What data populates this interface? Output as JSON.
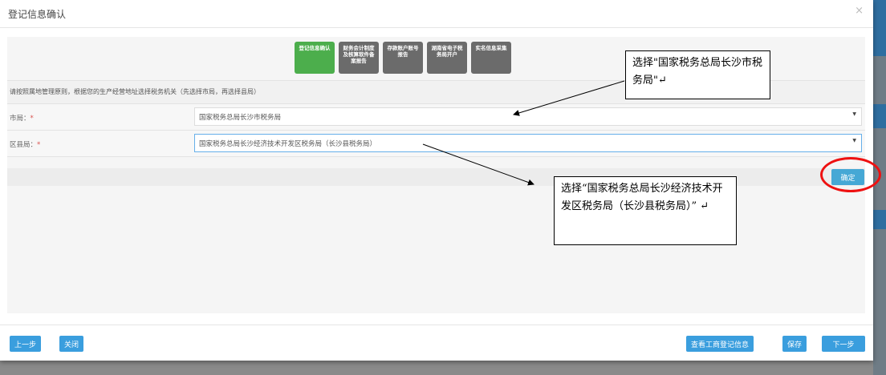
{
  "dialog": {
    "title": "登记信息确认",
    "close": "×"
  },
  "steps": [
    {
      "label": "登记信息确认",
      "active": true
    },
    {
      "label": "财务会计制度及核算软件备案报告"
    },
    {
      "label": "存款账户账号报告"
    },
    {
      "label": "湖南省电子税务局开户"
    },
    {
      "label": "实名信息采集"
    }
  ],
  "hint": "请按照属地管理原则，根据您的生产经营地址选择税务机关（先选择市局，再选择县局）",
  "fields": [
    {
      "label": "市局：",
      "required": "*",
      "value": "国家税务总局长沙市税务局"
    },
    {
      "label": "区县局：",
      "required": "*",
      "value": "国家税务总局长沙经济技术开发区税务局（长沙县税务局）"
    }
  ],
  "confirm": "确定",
  "footer": {
    "prev": "上一步",
    "close": "关闭",
    "view": "查看工商登记信息",
    "save": "保存",
    "next": "下一步"
  },
  "callouts": {
    "city": "选择\"国家税务总局长沙市税务局\"↵",
    "county": "选择“国家税务总局长沙经济技术开发区税务局（长沙县税务局）” ↵"
  }
}
